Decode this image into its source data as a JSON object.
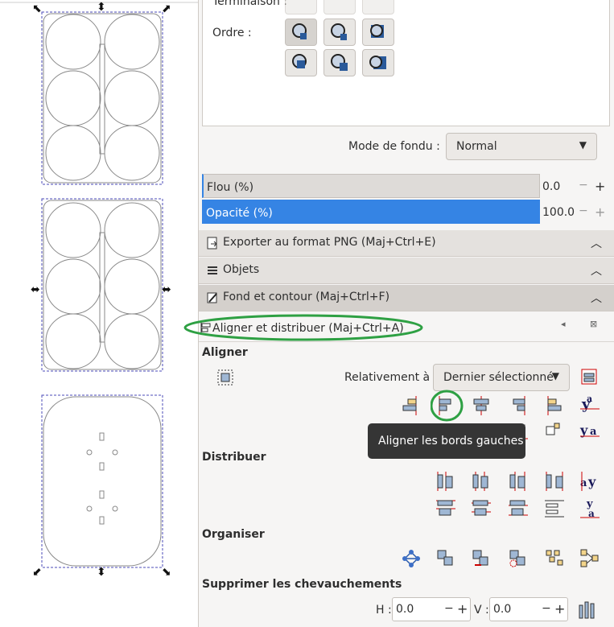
{
  "style_panel": {
    "terminaison_label": "Terminaison :",
    "ordre_label": "Ordre :",
    "mode_fondu_label": "Mode de fondu :",
    "mode_fondu_value": "Normal",
    "flou_label": "Flou (%)",
    "flou_value": "0.0",
    "opacite_label": "Opacité (%)",
    "opacite_value": "100.0"
  },
  "docks": [
    {
      "label": "Exporter au format PNG (Maj+Ctrl+E)"
    },
    {
      "label": "Objets"
    },
    {
      "label": "Fond et contour (Maj+Ctrl+F)"
    },
    {
      "label": "Aligner et distribuer (Maj+Ctrl+A)"
    }
  ],
  "align": {
    "aligner_title": "Aligner",
    "relativement_label": "Relativement à :",
    "relativement_value": "Dernier sélectionné",
    "tooltip": "Aligner les bords gauches",
    "distribuer_title": "Distribuer",
    "organiser_title": "Organiser",
    "chevauchements_title": "Supprimer les chevauchements",
    "h_label": "H :",
    "h_value": "0.0",
    "v_label": "V :",
    "v_value": "0.0",
    "minus": "−",
    "plus": "+"
  },
  "colors": {
    "highlight": "#3584e4",
    "annotation": "#2ea043"
  }
}
